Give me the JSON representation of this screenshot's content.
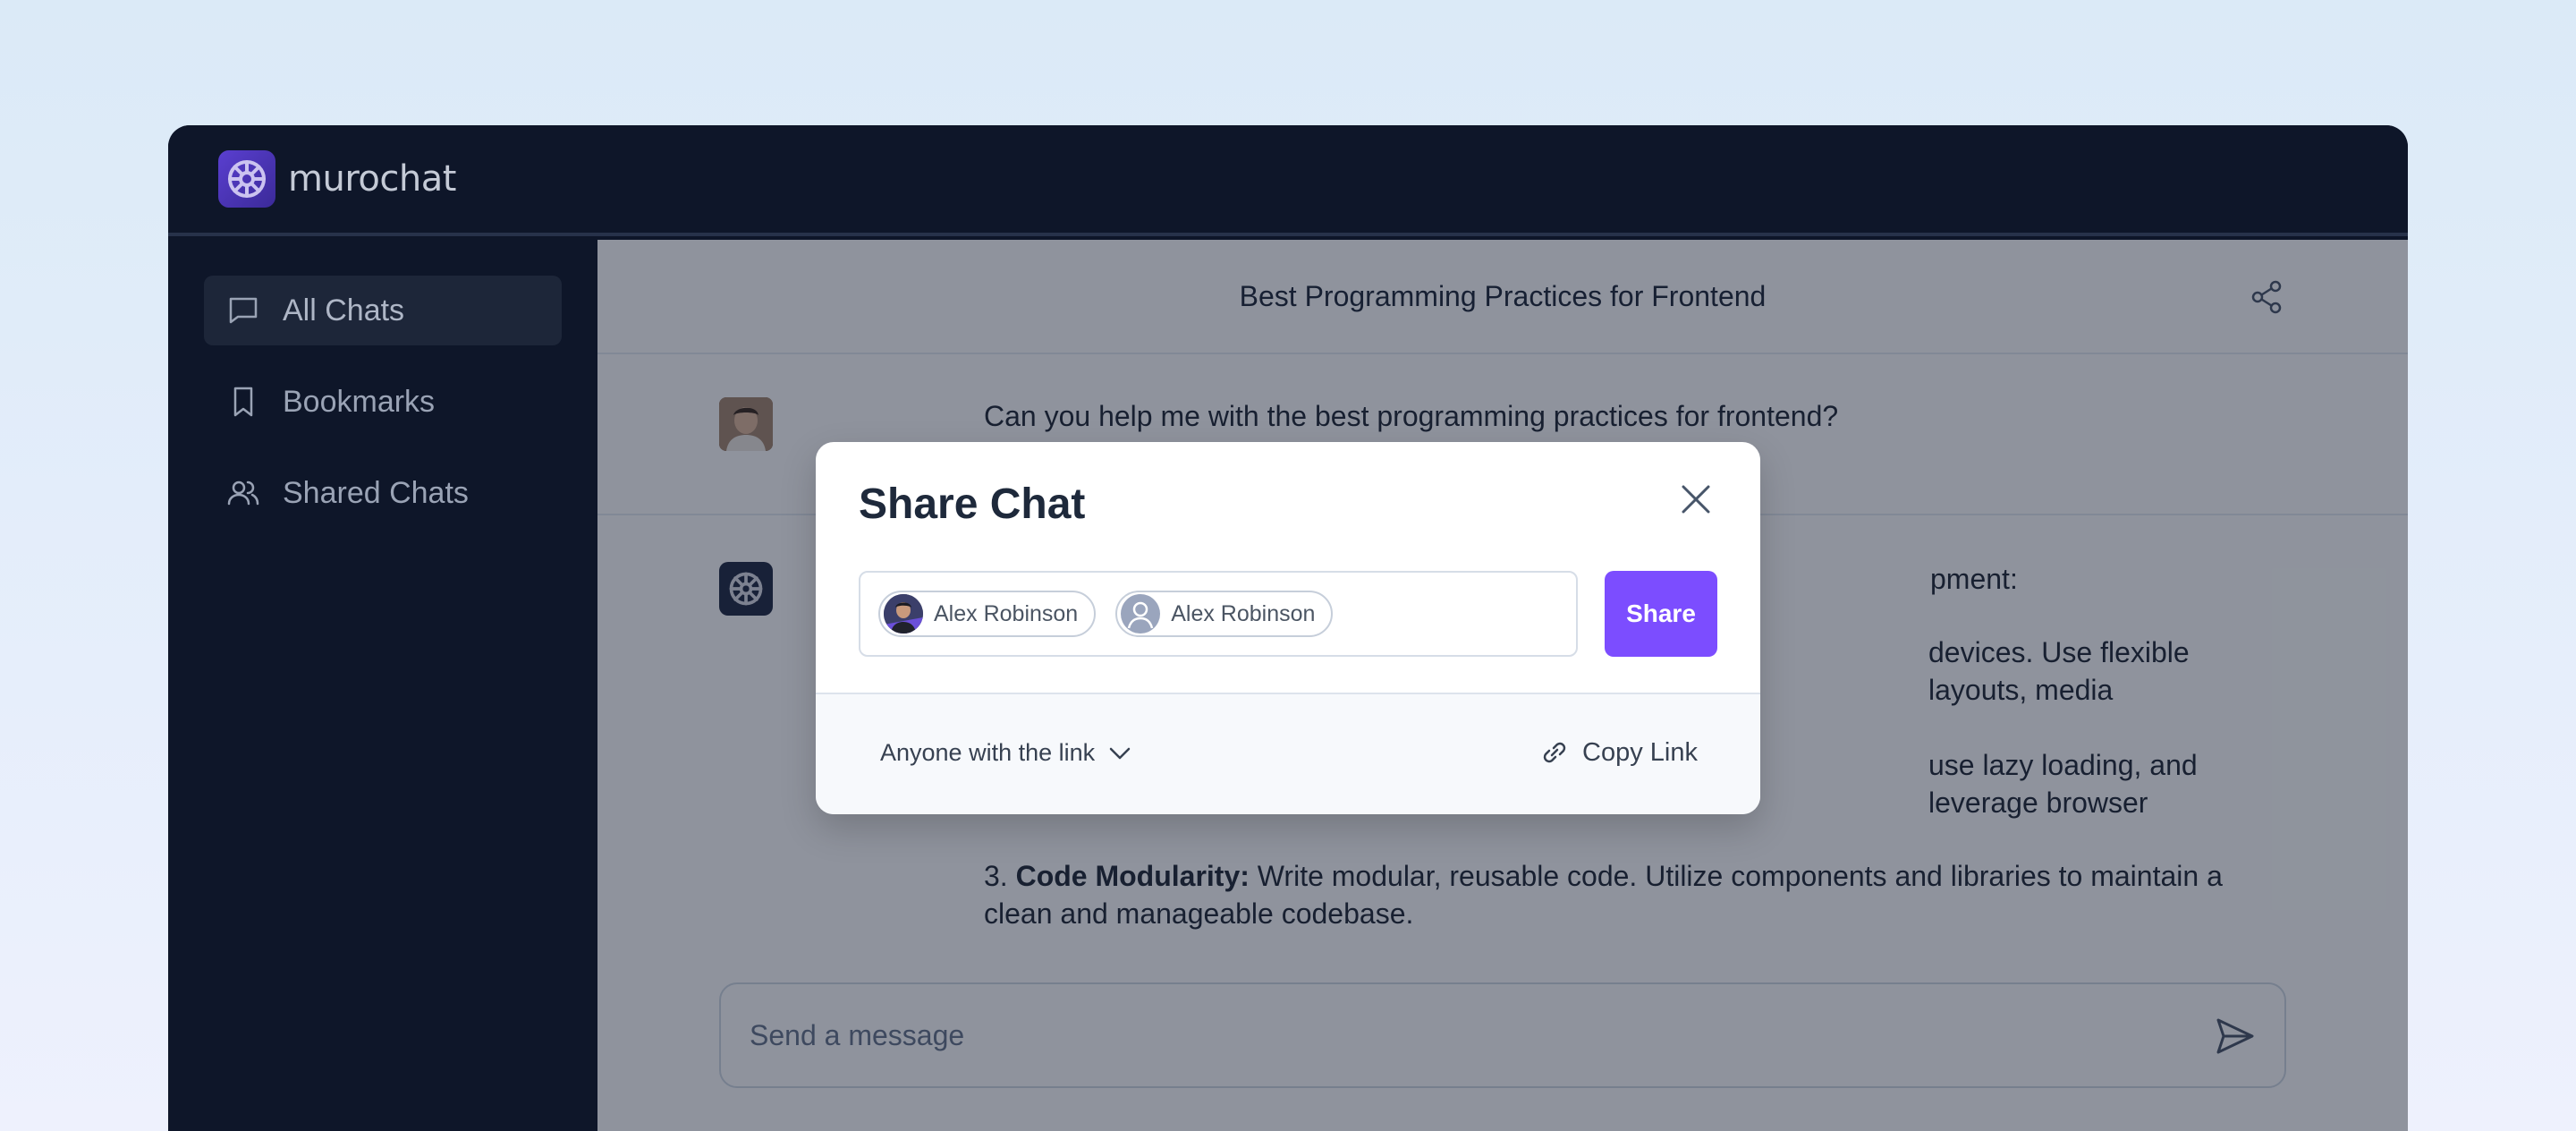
{
  "app": {
    "name": "murochat",
    "brand_color": "#5a3fd0",
    "logo_icon": "gear-flower-icon"
  },
  "sidebar": {
    "items": [
      {
        "label": "All Chats",
        "icon": "chat-bubble-icon",
        "active": true
      },
      {
        "label": "Bookmarks",
        "icon": "bookmark-icon",
        "active": false
      },
      {
        "label": "Shared Chats",
        "icon": "users-icon",
        "active": false
      }
    ]
  },
  "chat": {
    "title": "Best Programming Practices for Frontend",
    "share_icon": "share-icon",
    "user_message": "Can you help me with the best programming practices for frontend?",
    "assistant": {
      "intro_tail": "pment:",
      "line1_tail": "devices. Use flexible layouts, media",
      "line2_tail": "use lazy loading, and leverage browser",
      "item3_number": "3.",
      "item3_title": "Code Modularity:",
      "item3_text": "Write modular, reusable code. Utilize components and libraries to maintain a clean and manageable codebase."
    },
    "input": {
      "placeholder": "Send a message",
      "value": ""
    },
    "send_icon": "send-icon"
  },
  "modal": {
    "title": "Share Chat",
    "recipients": [
      {
        "name": "Alex Robinson",
        "avatar": "photo"
      },
      {
        "name": "Alex Robinson",
        "avatar": "placeholder"
      }
    ],
    "share_label": "Share",
    "permission_label": "Anyone with the link",
    "copy_link_label": "Copy Link",
    "accent_color": "#7c4dff"
  }
}
